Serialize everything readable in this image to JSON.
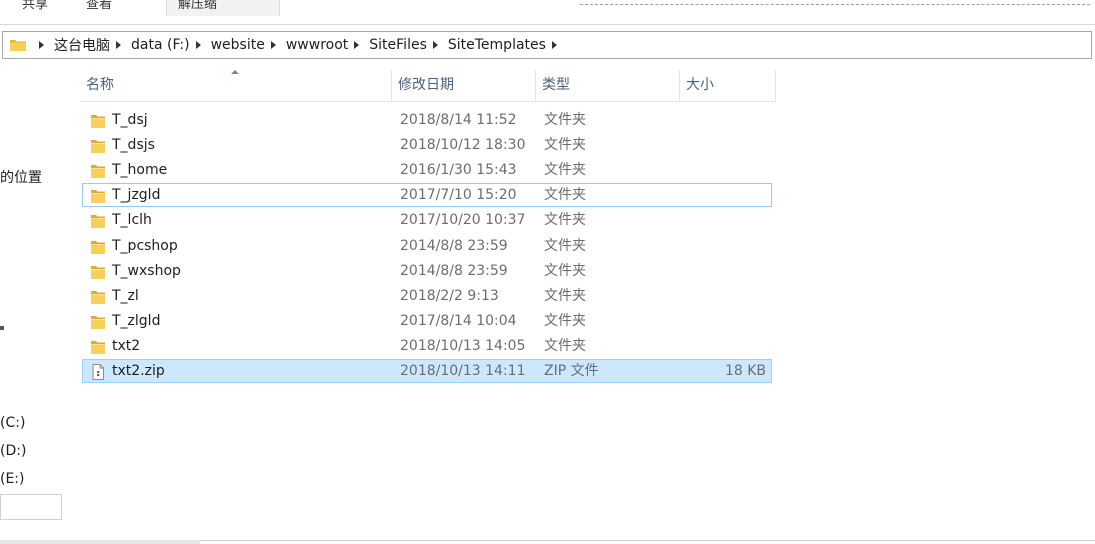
{
  "ribbon": {
    "tabs": [
      "共享",
      "查看",
      "解压缩"
    ]
  },
  "address": {
    "breadcrumb": [
      "这台电脑",
      "data (F:)",
      "website",
      "wwwroot",
      "SiteFiles",
      "SiteTemplates"
    ],
    "folder_icon": "folder-icon"
  },
  "nav": {
    "quick_access_fragment": "的位置",
    "drives": [
      "(C:)",
      "(D:)",
      "(E:)"
    ]
  },
  "columns": {
    "name": "名称",
    "date": "修改日期",
    "type": "类型",
    "size": "大小",
    "sorted_by": "名称"
  },
  "files": [
    {
      "name": "T_dsj",
      "date": "2018/8/14 11:52",
      "type": "文件夹",
      "size": "",
      "icon": "folder-icon"
    },
    {
      "name": "T_dsjs",
      "date": "2018/10/12 18:30",
      "type": "文件夹",
      "size": "",
      "icon": "folder-icon"
    },
    {
      "name": "T_home",
      "date": "2016/1/30 15:43",
      "type": "文件夹",
      "size": "",
      "icon": "folder-icon"
    },
    {
      "name": "T_jzgld",
      "date": "2017/7/10 15:20",
      "type": "文件夹",
      "size": "",
      "icon": "folder-icon"
    },
    {
      "name": "T_lclh",
      "date": "2017/10/20 10:37",
      "type": "文件夹",
      "size": "",
      "icon": "folder-icon"
    },
    {
      "name": "T_pcshop",
      "date": "2014/8/8 23:59",
      "type": "文件夹",
      "size": "",
      "icon": "folder-icon"
    },
    {
      "name": "T_wxshop",
      "date": "2014/8/8 23:59",
      "type": "文件夹",
      "size": "",
      "icon": "folder-icon"
    },
    {
      "name": "T_zl",
      "date": "2018/2/2 9:13",
      "type": "文件夹",
      "size": "",
      "icon": "folder-icon"
    },
    {
      "name": "T_zlgld",
      "date": "2017/8/14 10:04",
      "type": "文件夹",
      "size": "",
      "icon": "folder-icon"
    },
    {
      "name": "txt2",
      "date": "2018/10/13 14:05",
      "type": "文件夹",
      "size": "",
      "icon": "folder-icon"
    },
    {
      "name": "txt2.zip",
      "date": "2018/10/13 14:11",
      "type": "ZIP 文件",
      "size": "18 KB",
      "icon": "zip-file-icon"
    }
  ],
  "state": {
    "focused_index": 3,
    "selected_index": 10
  },
  "colors": {
    "selection_bg": "#cce8ff",
    "selection_border": "#99d1ff",
    "focus_border": "#99c9ef",
    "header_text": "#4c607a",
    "folder_yellow": "#f4c84a"
  }
}
